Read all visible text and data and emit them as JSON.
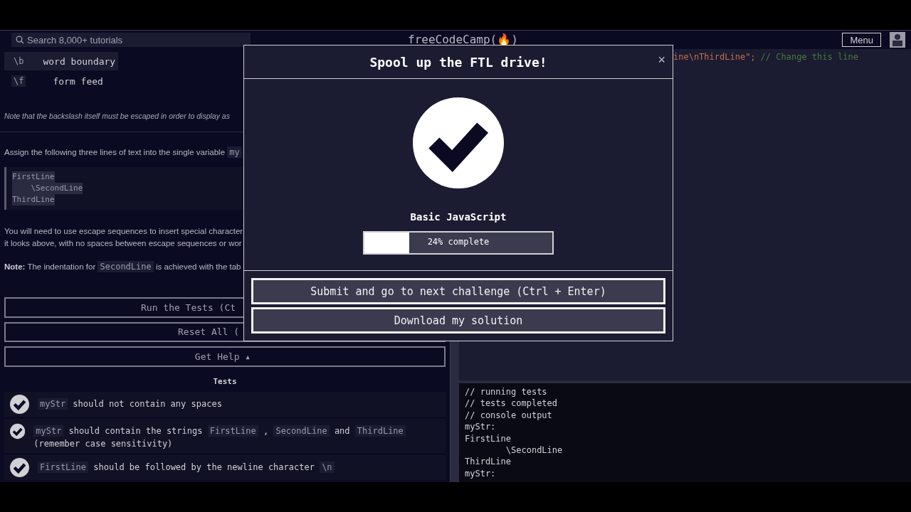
{
  "navbar": {
    "search_placeholder": "Search 8,000+ tutorials",
    "logo": "freeCodeCamp(🔥)",
    "menu_button": "Menu"
  },
  "lesson": {
    "escape_table": [
      {
        "code": "\\b",
        "meaning": "word boundary"
      },
      {
        "code": "\\f",
        "meaning": "form feed"
      }
    ],
    "note": "Note that the backslash itself must be escaped in order to display as",
    "assign": [
      {
        "kind": "text",
        "text": "Assign the following three lines of text into the single variable"
      },
      {
        "kind": "code",
        "text": "my"
      }
    ],
    "quote_lines": [
      "FirstLine",
      "    \\SecondLine",
      "ThirdLine"
    ],
    "paragraph_lines": [
      "You will need to use escape sequences to insert special character",
      "it looks above, with no spaces between escape sequences or wor"
    ],
    "indent_note": [
      {
        "kind": "text",
        "text": "**Note:** The indentation for"
      },
      {
        "kind": "code",
        "text": "SecondLine"
      },
      {
        "kind": "text",
        "text": "is achieved with the tab"
      }
    ],
    "buttons": [
      "Run the Tests (Ct",
      "Reset All (",
      "Get Help ▴"
    ],
    "tests_heading": "Tests",
    "tests": [
      {
        "passed": true,
        "parts": [
          {
            "kind": "code",
            "text": "myStr"
          },
          {
            "kind": "text",
            "text": "should not contain any spaces"
          }
        ]
      },
      {
        "passed": true,
        "parts": [
          {
            "kind": "code",
            "text": "myStr"
          },
          {
            "kind": "text",
            "text": "should contain the strings"
          },
          {
            "kind": "code",
            "text": "FirstLine"
          },
          {
            "kind": "text",
            "text": ","
          },
          {
            "kind": "code",
            "text": "SecondLine"
          },
          {
            "kind": "text",
            "text": "and"
          },
          {
            "kind": "code",
            "text": "ThirdLine"
          },
          {
            "kind": "text",
            "text": "(remember case sensitivity)"
          }
        ]
      },
      {
        "passed": true,
        "parts": [
          {
            "kind": "code",
            "text": "FirstLine"
          },
          {
            "kind": "text",
            "text": "should be followed by the newline character"
          },
          {
            "kind": "code",
            "text": "\\n"
          }
        ]
      }
    ]
  },
  "editor": {
    "code_line": [
      {
        "kind": "string",
        "text": "ine\\nThirdLine\";"
      },
      {
        "kind": "comment",
        "text": "// Change this line"
      }
    ]
  },
  "console": [
    "// running tests",
    "// tests completed",
    "// console output",
    "myStr:",
    "FirstLine",
    "        \\SecondLine",
    "ThirdLine",
    "myStr:"
  ],
  "modal": {
    "title": "Spool up the FTL drive!",
    "close": "×",
    "block_title": "Basic JavaScript",
    "progress": {
      "level": 0.24,
      "label": "24% complete"
    },
    "buttons": [
      "Submit and go to next challenge (Ctrl + Enter)",
      "Download my solution"
    ]
  }
}
